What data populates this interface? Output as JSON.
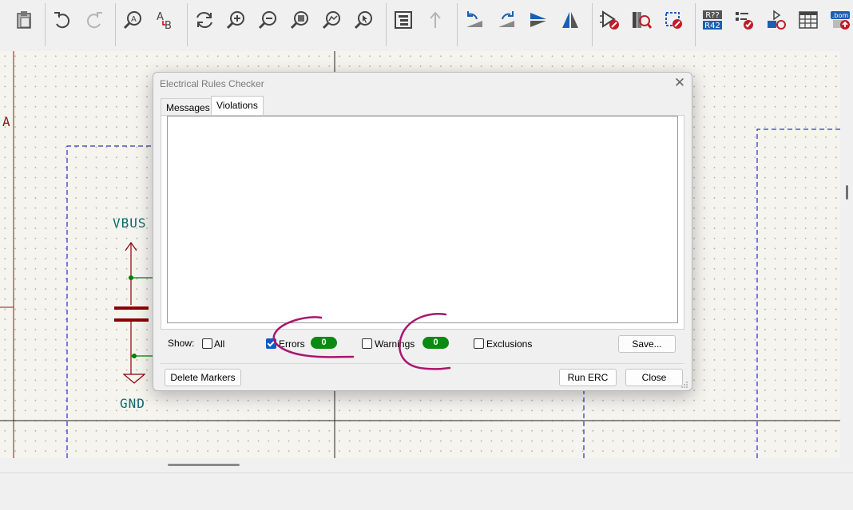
{
  "toolbar": {
    "icons": [
      "paste-icon",
      "undo-icon",
      "redo-icon",
      "find-icon",
      "find-replace-icon",
      "refresh-icon",
      "zoom-in-icon",
      "zoom-out-icon",
      "zoom-fit-icon",
      "zoom-objects-icon",
      "zoom-selection-icon",
      "hierarchy-navigator-icon",
      "leave-sheet-icon",
      "rotate-ccw-icon",
      "rotate-cw-icon",
      "mirror-vertical-icon",
      "mirror-horizontal-icon",
      "symbol-editor-icon",
      "symbol-browser-icon",
      "footprint-editor-icon",
      "annotate-icon",
      "erc-icon",
      "assign-footprints-icon",
      "symbol-fields-table-icon",
      "bom-icon"
    ],
    "annotate_text": "R??",
    "annotate_text2": "R42",
    "bom_text": ".bom"
  },
  "schematic": {
    "label_vbus": "VBUS",
    "label_gnd": "GND",
    "label_a": "A"
  },
  "dialog": {
    "title": "Electrical Rules Checker",
    "close_glyph": "✕",
    "tabs": [
      {
        "label": "Messages",
        "active": false
      },
      {
        "label": "Violations",
        "active": true
      }
    ],
    "show_label": "Show:",
    "filters": {
      "all": {
        "label": "All",
        "checked": false
      },
      "errors": {
        "label": "Errors",
        "checked": true,
        "count": "0"
      },
      "warnings": {
        "label": "Warnings",
        "checked": false,
        "count": "0"
      },
      "exclusions": {
        "label": "Exclusions",
        "checked": false
      }
    },
    "buttons": {
      "save": "Save...",
      "delete_markers": "Delete Markers",
      "run_erc": "Run ERC",
      "close": "Close"
    }
  },
  "colors": {
    "badge": "#0a8a12",
    "annotation_stroke": "#a8176f",
    "wire": "#008000",
    "component": "#8b0000",
    "sheet_border": "#0000c0"
  }
}
